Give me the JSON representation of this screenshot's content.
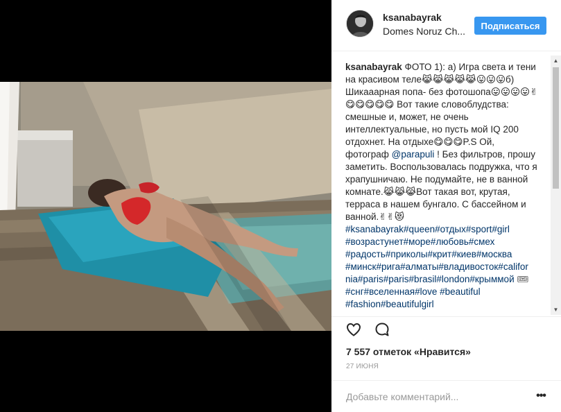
{
  "post": {
    "username": "ksanabayrak",
    "location": "Domes Noruz Ch...",
    "follow_label": "Подписаться",
    "caption": {
      "author": "ksanabayrak",
      "text_1": " ФОТО 1): а) Игра света и тени на красивом теле😹😹😹😹😹😛😛😛б) Шикааарная попа- без фотошопа😛😛😛😛✌😋😋😋😋😋 Вот такие словоблудства: смешные и, может, не очень интеллектуальные, но пусть мой IQ 200 отдохнет. На отдыхе😋😋😋P.S Ой, фотограф ",
      "mention": "@parapuli",
      "text_2": " ! Без фильтров, прошу заметить. Воспользовалась подружка, что я храпушничаю. Не подумайте, не в ванной комнате.😹😹😹Вот такая вот, крутая, терраса в нашем бунгало. С бассейном и ванной.✌✌😻 ",
      "hashtags_1": "#ksanabayrak#queen#отдых#sport#girl #возрастунет#море#любовь#смех #радость#приколы#крит#киев#москва #минск#рига#алматы#владивосток#califor nia#paris#paris#brasil#london#крыммой",
      "text_3": " 🎟",
      "hashtags_2": "#снг#вселенная#love #beautiful #fashion#beautifulgirl"
    },
    "likes": "7 557 отметок «Нравится»",
    "date": "27 ИЮНЯ",
    "comment_placeholder": "Добавьте комментарий...",
    "more_label": "•••"
  },
  "icons": {
    "like": "heart-icon",
    "comment": "comment-icon",
    "more": "more-options-icon"
  },
  "colors": {
    "follow_button": "#3897f0",
    "link": "#003569",
    "muted": "#999999",
    "media_background": "#000000"
  }
}
